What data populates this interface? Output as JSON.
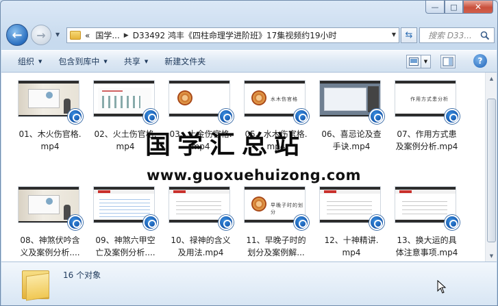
{
  "window": {
    "controls": {
      "minimize": "—",
      "maximize": "□",
      "close": "✕"
    }
  },
  "nav": {
    "back_glyph": "←",
    "forward_glyph": "→",
    "breadcrumb": {
      "overflow": "«",
      "parent": "国学...",
      "current": "D33492 鸿丰《四柱命理学进阶班》17集视频约19小时"
    },
    "search_placeholder": "搜索 D33..."
  },
  "toolbar": {
    "organize": "组织",
    "include_in_library": "包含到库中",
    "share": "共享",
    "new_folder": "新建文件夹",
    "help": "?"
  },
  "files": [
    {
      "line1": "01、木火伤官格.",
      "line2": "mp4",
      "thumb": "classroom"
    },
    {
      "line1": "02、火土伤官格.",
      "line2": "mp4",
      "thumb": "whiteboard"
    },
    {
      "line1": "03、土金伤官格.",
      "line2": "mp4",
      "thumb": "seal"
    },
    {
      "line1": "05、水木伤官格.",
      "line2": "mp4",
      "thumb": "seal-title",
      "thumb_title": "水木伤官格"
    },
    {
      "line1": "06、喜忌论及查",
      "line2": "手诀.mp4",
      "thumb": "screen"
    },
    {
      "line1": "07、作用方式患",
      "line2": "及案例分析.mp4",
      "thumb": "title",
      "thumb_title": "作用方式患分析"
    },
    {
      "line1": "08、神煞伏吟含",
      "line2": "义及案例分析....",
      "thumb": "classroom"
    },
    {
      "line1": "09、神煞六甲空",
      "line2": "亡及案例分析....",
      "thumb": "table"
    },
    {
      "line1": "10、禄神的含义",
      "line2": "及用法.mp4",
      "thumb": "slide"
    },
    {
      "line1": "11、早晚子时的",
      "line2": "划分及案例解...",
      "thumb": "seal-title",
      "thumb_title": "早晚子时的划分"
    },
    {
      "line1": "12、十神精讲.",
      "line2": "mp4",
      "thumb": "slide"
    },
    {
      "line1": "13、换大运的具",
      "line2": "体注意事项.mp4",
      "thumb": "slide"
    }
  ],
  "watermark": {
    "title": "国学汇总站",
    "url": "www.guoxuehuizong.com"
  },
  "status": {
    "count": "16 个对象"
  }
}
